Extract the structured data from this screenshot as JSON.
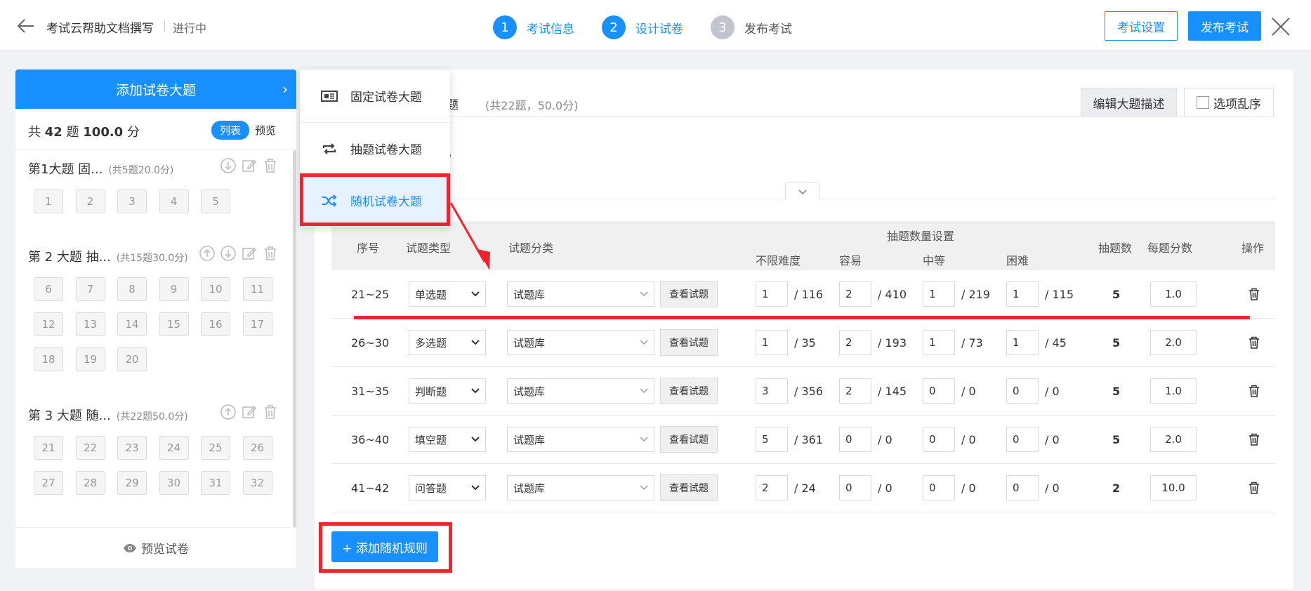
{
  "header": {
    "doc_title": "考试云帮助文档撰写",
    "status": "进行中",
    "steps": [
      {
        "num": "1",
        "label": "考试信息",
        "state": "done"
      },
      {
        "num": "2",
        "label": "设计试卷",
        "state": "active"
      },
      {
        "num": "3",
        "label": "发布考试",
        "state": "pending"
      }
    ],
    "settings_label": "考试设置",
    "publish_label": "发布考试"
  },
  "colors": {
    "primary": "#1890ff",
    "annotation": "#f5222d",
    "grey_step": "#c0c4cc"
  },
  "left": {
    "add_title": "添加试卷大题",
    "summary_prefix": "共",
    "summary_count": "42",
    "summary_mid": "题",
    "summary_score": "100.0",
    "summary_suffix": "分",
    "view_list": "列表",
    "view_preview": "预览",
    "sections": [
      {
        "title": "第1大题 固...",
        "sub": "(共5题20.0分)",
        "questions": [
          "1",
          "2",
          "3",
          "4",
          "5"
        ]
      },
      {
        "title": "第 2 大题 抽...",
        "sub": "(共15题30.0分)",
        "questions": [
          "6",
          "7",
          "8",
          "9",
          "10",
          "11",
          "12",
          "13",
          "14",
          "15",
          "16",
          "17",
          "18",
          "19",
          "20"
        ]
      },
      {
        "title": "第 3 大题 随...",
        "sub": "(共22题50.0分)",
        "questions": [
          "21",
          "22",
          "23",
          "24",
          "25",
          "26",
          "27",
          "28",
          "29",
          "30",
          "31",
          "32"
        ]
      }
    ],
    "preview_label": "预览试卷"
  },
  "menu": {
    "items": [
      {
        "label": "固定试卷大题",
        "icon": "fixed-paper-icon"
      },
      {
        "label": "抽题试卷大题",
        "icon": "swap-icon"
      },
      {
        "label": "随机试卷大题",
        "icon": "shuffle-icon"
      }
    ]
  },
  "main": {
    "section_title_tail": "题",
    "section_count": "(共22题，50.0分)",
    "edit_desc": "编辑大题描述",
    "shuffle_options": "选项乱序",
    "desc_tail": "。",
    "columns": {
      "index": "序号",
      "type": "试题类型",
      "category": "试题分类",
      "quota_group": "抽题数量设置",
      "any": "不限难度",
      "easy": "容易",
      "medium": "中等",
      "hard": "困难",
      "count": "抽题数",
      "score": "每题分数",
      "ops": "操作"
    },
    "view_questions": "查看试题",
    "rules": [
      {
        "range": "21~25",
        "type": "单选题",
        "category": "试题库",
        "any": "1",
        "any_total": "/ 116",
        "easy": "2",
        "easy_total": "/ 410",
        "medium": "1",
        "medium_total": "/ 219",
        "hard": "1",
        "hard_total": "/ 115",
        "count": "5",
        "score": "1.0"
      },
      {
        "range": "26~30",
        "type": "多选题",
        "category": "试题库",
        "any": "1",
        "any_total": "/ 35",
        "easy": "2",
        "easy_total": "/ 193",
        "medium": "1",
        "medium_total": "/ 73",
        "hard": "1",
        "hard_total": "/ 45",
        "count": "5",
        "score": "2.0"
      },
      {
        "range": "31~35",
        "type": "判断题",
        "category": "试题库",
        "any": "3",
        "any_total": "/ 356",
        "easy": "2",
        "easy_total": "/ 145",
        "medium": "0",
        "medium_total": "/ 0",
        "hard": "0",
        "hard_total": "/ 0",
        "count": "5",
        "score": "1.0"
      },
      {
        "range": "36~40",
        "type": "填空题",
        "category": "试题库",
        "any": "5",
        "any_total": "/ 361",
        "easy": "0",
        "easy_total": "/ 0",
        "medium": "0",
        "medium_total": "/ 0",
        "hard": "0",
        "hard_total": "/ 0",
        "count": "5",
        "score": "2.0"
      },
      {
        "range": "41~42",
        "type": "问答题",
        "category": "试题库",
        "any": "2",
        "any_total": "/ 24",
        "easy": "0",
        "easy_total": "/ 0",
        "medium": "0",
        "medium_total": "/ 0",
        "hard": "0",
        "hard_total": "/ 0",
        "count": "2",
        "score": "10.0"
      }
    ],
    "add_rule": "+ 添加随机规则"
  }
}
